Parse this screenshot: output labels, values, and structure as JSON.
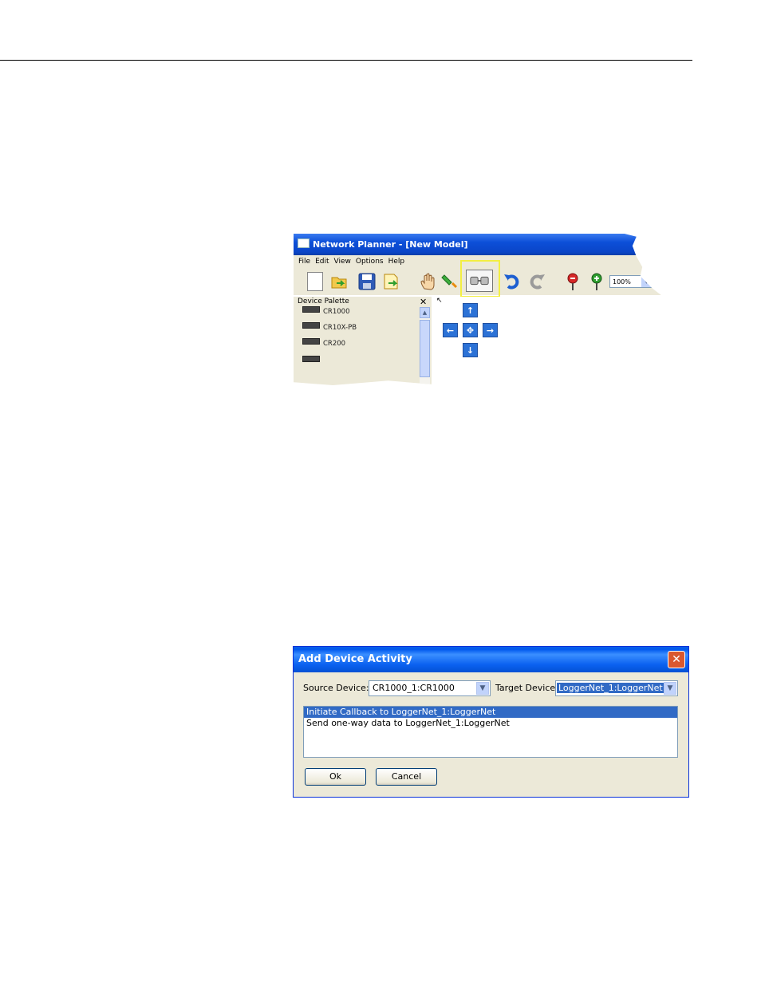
{
  "network_planner": {
    "title": "Network Planner - [New Model]",
    "menu": [
      "File",
      "Edit",
      "View",
      "Options",
      "Help"
    ],
    "zoom": "100%",
    "palette": {
      "title": "Device Palette",
      "items": [
        "CR1000",
        "CR10X-PB",
        "CR200"
      ]
    }
  },
  "dialog": {
    "title": "Add Device Activity",
    "source_label": "Source Device:",
    "source_value": "CR1000_1:CR1000",
    "target_label": "Target Device:",
    "target_value": "LoggerNet_1:LoggerNet",
    "activities": [
      "Initiate Callback to LoggerNet_1:LoggerNet",
      "Send one-way data to LoggerNet_1:LoggerNet"
    ],
    "ok_label": "Ok",
    "cancel_label": "Cancel"
  }
}
